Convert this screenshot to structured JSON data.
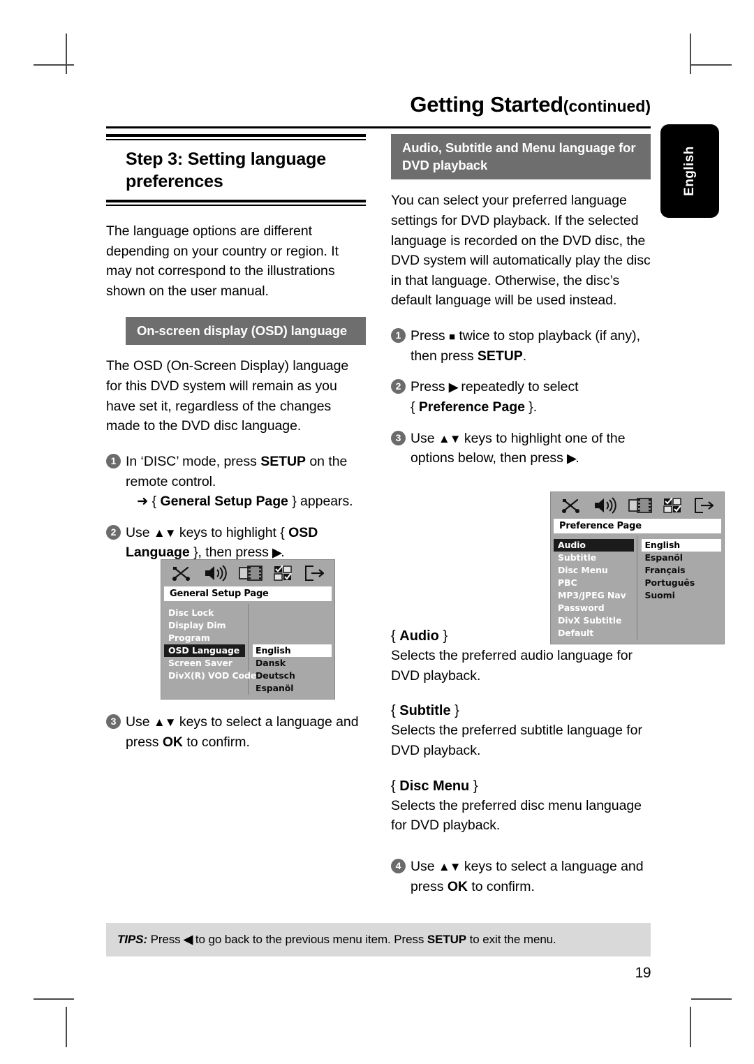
{
  "header": {
    "title": "Getting Started",
    "continued": "(continued)"
  },
  "side_tab": {
    "label": "English"
  },
  "left_column": {
    "step_heading": "Step 3:  Setting language preferences",
    "intro": "The language options are different depending on your country or region.  It may not correspond to the illustrations shown on the user manual.",
    "section_bar": "On-screen display (OSD) language",
    "section_body": "The OSD (On-Screen Display) language for this DVD system will remain as you have set it, regardless of the changes made to the DVD disc language.",
    "steps": [
      {
        "num": "1",
        "text_pre": "In ‘DISC’ mode, press ",
        "bold1": "SETUP",
        "text_mid": " on the remote control.",
        "arrow_pre": "{ ",
        "arrow_bold": "General Setup Page",
        "arrow_post": " } appears."
      },
      {
        "num": "2",
        "text_pre": "Use ",
        "keys": "▲▼",
        "text_mid": " keys to highlight { ",
        "bold1": "OSD Language",
        "text_post": " }, then press ",
        "arrow": "▶",
        "text_end": "."
      },
      {
        "num": "3",
        "text_pre": "Use ",
        "keys": "▲▼",
        "text_mid": " keys to select a language and press ",
        "bold1": "OK",
        "text_post": " to confirm."
      }
    ]
  },
  "right_column": {
    "section_bar": "Audio, Subtitle and Menu language for DVD playback",
    "section_body": "You can select your preferred language settings for DVD playback.  If the selected language is recorded on the DVD disc, the DVD system will automatically play the disc in that language.  Otherwise, the disc’s default language will be used instead.",
    "steps": [
      {
        "num": "1",
        "text_pre": "Press ",
        "glyph": "■",
        "text_mid": " twice to stop playback (if any), then press ",
        "bold1": "SETUP",
        "text_post": "."
      },
      {
        "num": "2",
        "text_pre": "Press ",
        "arrow": "▶",
        "text_mid": " repeatedly to select ",
        "brace_open": "{ ",
        "bold1": "Preference Page",
        "brace_close": " }."
      },
      {
        "num": "3",
        "text_pre": "Use ",
        "keys": "▲▼",
        "text_mid": " keys to highlight one of the options below, then press ",
        "arrow": "▶",
        "text_post": "."
      },
      {
        "num": "4",
        "text_pre": "Use ",
        "keys": "▲▼",
        "text_mid": " keys to select a language and press ",
        "bold1": "OK",
        "text_post": " to confirm."
      }
    ],
    "definitions": [
      {
        "open": "{ ",
        "term": "Audio",
        "close": " }",
        "desc": "Selects the preferred audio language for DVD playback."
      },
      {
        "open": "{ ",
        "term": "Subtitle",
        "close": " }",
        "desc": "Selects the preferred subtitle language for DVD playback."
      },
      {
        "open": "{ ",
        "term": "Disc Menu",
        "close": " }",
        "desc": "Selects the preferred disc menu language for DVD playback."
      }
    ]
  },
  "osd_general": {
    "title": "General Setup Page",
    "icons": [
      "tools-icon",
      "speaker-icon",
      "video-icon",
      "preference-icon",
      "exit-icon"
    ],
    "menu_items": [
      {
        "label": "Disc Lock",
        "selected": false
      },
      {
        "label": "Display Dim",
        "selected": false
      },
      {
        "label": "Program",
        "selected": false
      },
      {
        "label": "OSD Language",
        "selected": true
      },
      {
        "label": "Screen Saver",
        "selected": false
      },
      {
        "label": "DivX(R) VOD Code",
        "selected": false
      }
    ],
    "values": [
      {
        "label": "English",
        "selected": true
      },
      {
        "label": "Dansk",
        "selected": false
      },
      {
        "label": "Deutsch",
        "selected": false
      },
      {
        "label": "Espanöl",
        "selected": false
      }
    ]
  },
  "osd_preference": {
    "title": "Preference Page",
    "icons": [
      "tools-icon",
      "speaker-icon",
      "video-icon",
      "preference-icon",
      "exit-icon"
    ],
    "menu_items": [
      {
        "label": "Audio",
        "selected": true
      },
      {
        "label": "Subtitle",
        "selected": false
      },
      {
        "label": "Disc Menu",
        "selected": false
      },
      {
        "label": "PBC",
        "selected": false
      },
      {
        "label": "MP3/JPEG Nav",
        "selected": false
      },
      {
        "label": "Password",
        "selected": false
      },
      {
        "label": "DivX Subtitle",
        "selected": false
      },
      {
        "label": "Default",
        "selected": false
      }
    ],
    "values": [
      {
        "label": "English",
        "selected": true
      },
      {
        "label": "Espanöl",
        "selected": false
      },
      {
        "label": "Français",
        "selected": false
      },
      {
        "label": "Português",
        "selected": false
      },
      {
        "label": "Suomi",
        "selected": false
      }
    ]
  },
  "tips": {
    "label": "TIPS:",
    "text_pre": " Press ",
    "arrow": "◀",
    "text_mid": " to go back to the previous menu item.  Press ",
    "bold1": "SETUP",
    "text_post": " to exit the menu."
  },
  "folio": {
    "page_number": "19"
  },
  "colors": {
    "bar_grey": "#6e6e6e",
    "tips_grey": "#d9d9d9",
    "osd_bg": "#a8a8a8",
    "osd_selected": "#1b1b1b"
  }
}
